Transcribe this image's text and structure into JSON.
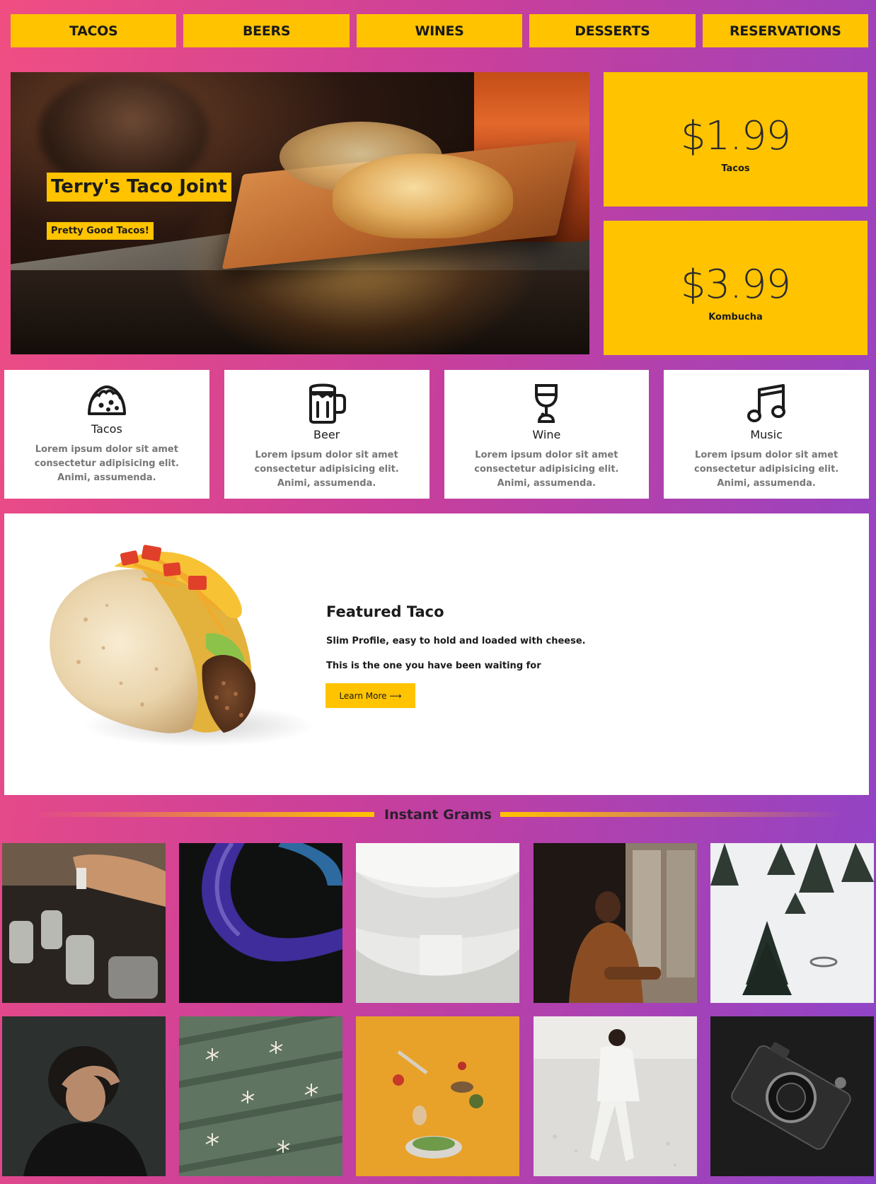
{
  "nav": {
    "items": [
      "TACOS",
      "BEERS",
      "WINES",
      "DESSERTS",
      "RESERVATIONS"
    ]
  },
  "hero": {
    "title": "Terry's Taco Joint",
    "subtitle": "Pretty Good Tacos!"
  },
  "prices": [
    {
      "amount": "$1.99",
      "item": "Tacos"
    },
    {
      "amount": "$3.99",
      "item": "Kombucha"
    }
  ],
  "features": [
    {
      "icon": "taco-icon",
      "title": "Tacos",
      "desc": "Lorem ipsum dolor sit amet consectetur adipisicing elit. Animi, assumenda."
    },
    {
      "icon": "beer-mug-icon",
      "title": "Beer",
      "desc": "Lorem ipsum dolor sit amet consectetur adipisicing elit. Animi, assumenda."
    },
    {
      "icon": "wine-glass-icon",
      "title": "Wine",
      "desc": "Lorem ipsum dolor sit amet consectetur adipisicing elit. Animi, assumenda."
    },
    {
      "icon": "music-note-icon",
      "title": "Music",
      "desc": "Lorem ipsum dolor sit amet consectetur adipisicing elit. Animi, assumenda."
    }
  ],
  "featured": {
    "heading": "Featured Taco",
    "line1": "Slim Profile, easy to hold and loaded with cheese.",
    "line2": "This is the one you have been waiting for",
    "button": "Learn More ⟶"
  },
  "grams": {
    "title": "Instant Grams"
  },
  "colors": {
    "accent": "#ffc300",
    "gradient_start": "#f04e82",
    "gradient_end": "#8d44c9"
  }
}
